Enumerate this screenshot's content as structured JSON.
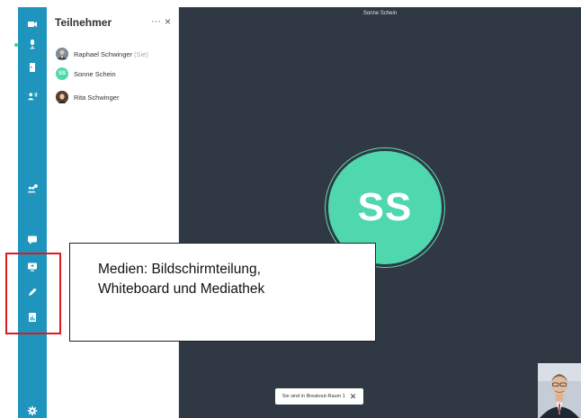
{
  "panel": {
    "title": "Teilnehmer",
    "more_glyph": "···",
    "close_glyph": "×",
    "participants": [
      {
        "name": "Raphael Schwinger",
        "suffix": "(Sie)",
        "avatar": "photo"
      },
      {
        "name": "Sonne Schein",
        "initials": "SS",
        "avatar_color": "#4fd8ae"
      },
      {
        "name": "Rita Schwinger",
        "avatar": "photo"
      }
    ]
  },
  "rail": {
    "background": "#1f95be",
    "icons": [
      "camera-icon",
      "microphone-icon",
      "door-icon",
      "group-talk-icon",
      "breakout-users-icon",
      "chat-icon",
      "screen-share-icon",
      "pen-icon",
      "media-library-icon",
      "gear-icon"
    ]
  },
  "stage": {
    "title": "Sonne Schein",
    "avatar_initials": "SS",
    "avatar_color": "#4fd8ae",
    "background": "#2f3843",
    "breakout_text": "Sie sind in Breakout-Raum 1",
    "breakout_close": "✕"
  },
  "annotation": {
    "line1": "Medien: Bildschirmteilung,",
    "line2": "Whiteboard und Mediathek",
    "highlight_color": "#e0191f"
  }
}
